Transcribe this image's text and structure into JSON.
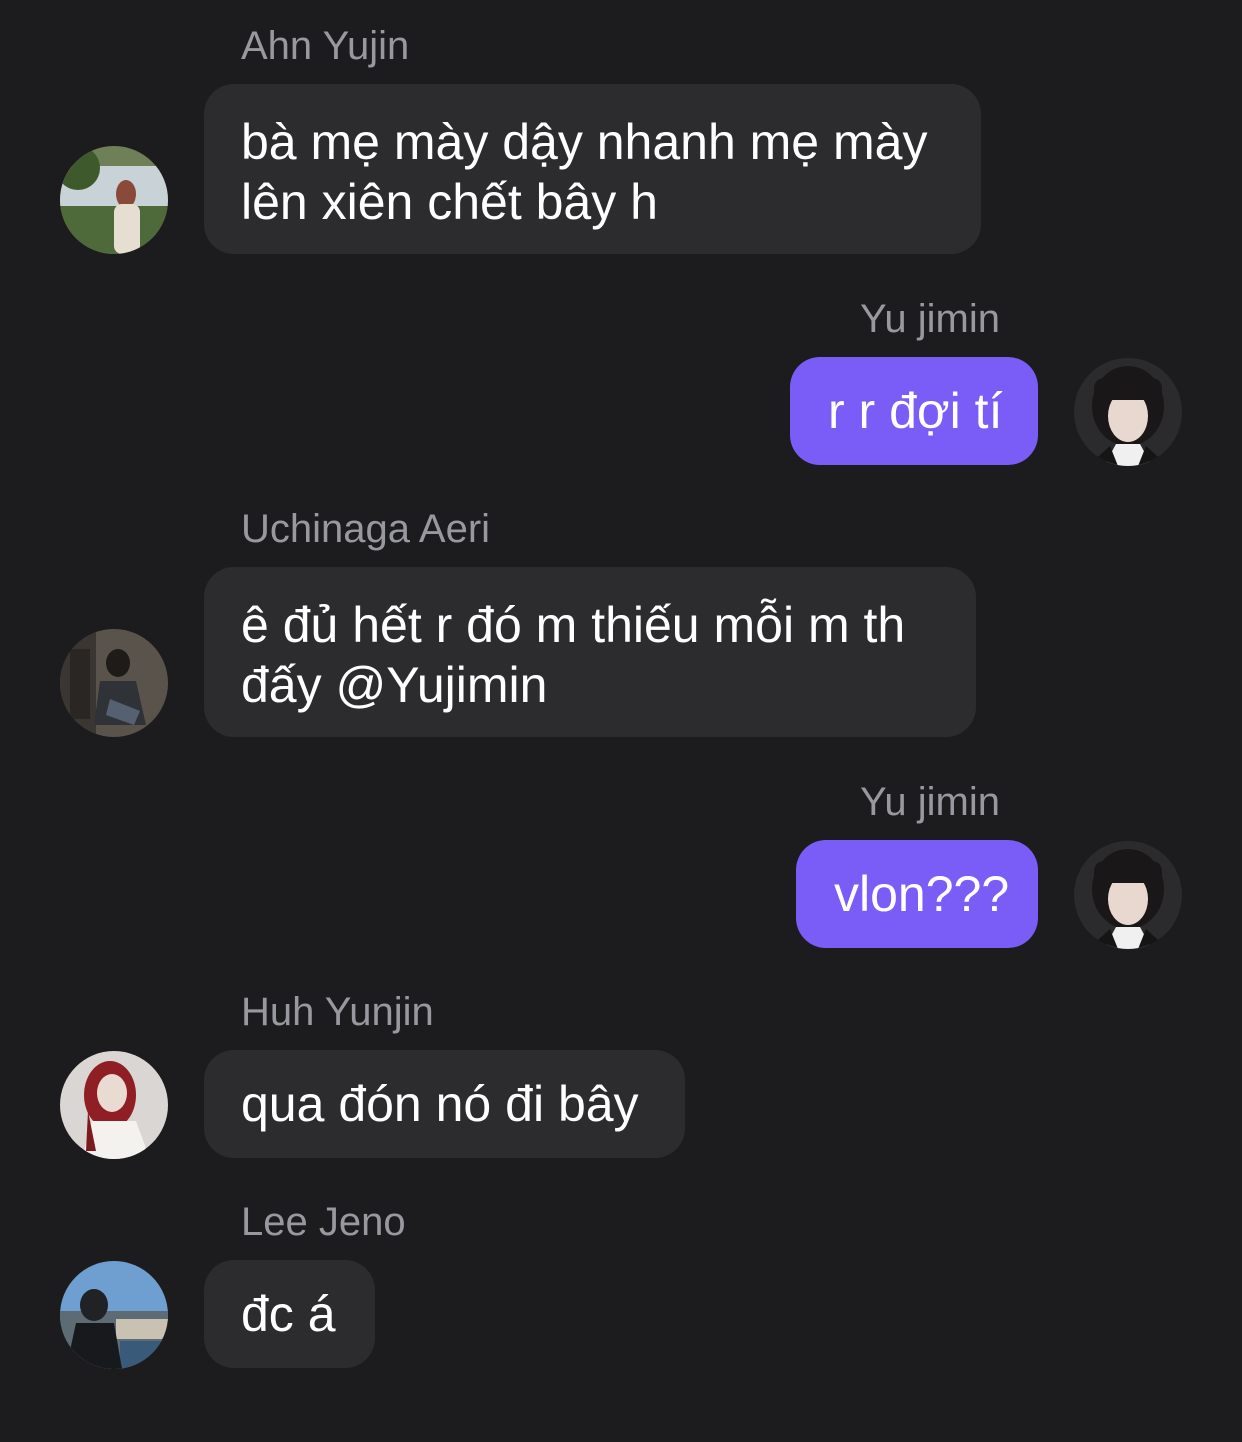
{
  "messages": [
    {
      "sender": "Ahn Yujin",
      "direction": "incoming",
      "lines": [
        "bà mẹ mày dậy nhanh mẹ mày",
        "lên xiên chết bây h"
      ],
      "avatar_icon": "profile-photo-outdoor-lake"
    },
    {
      "sender": "Yu jimin",
      "direction": "outgoing",
      "lines": [
        "r r đợi tí"
      ],
      "avatar_icon": "profile-photo-portrait-dark-hair"
    },
    {
      "sender": "Uchinaga Aeri",
      "direction": "incoming",
      "lines": [
        "ê đủ hết r đó m thiếu mỗi m th",
        "đấy @Yujimin"
      ],
      "avatar_icon": "profile-photo-seated-dark"
    },
    {
      "sender": "Yu jimin",
      "direction": "outgoing",
      "lines": [
        "vlon???"
      ],
      "avatar_icon": "profile-photo-portrait-dark-hair"
    },
    {
      "sender": "Huh Yunjin",
      "direction": "incoming",
      "lines": [
        "qua đón nó đi bây"
      ],
      "avatar_icon": "profile-photo-red-hair"
    },
    {
      "sender": "Lee Jeno",
      "direction": "incoming",
      "lines": [
        "đc á"
      ],
      "avatar_icon": "profile-photo-city-harbor"
    }
  ],
  "colors": {
    "background": "#1c1c1e",
    "incoming_bubble": "#2c2c2e",
    "outgoing_bubble": "#7a5cf7",
    "sender_name": "#98989f",
    "message_text": "#ffffff"
  }
}
